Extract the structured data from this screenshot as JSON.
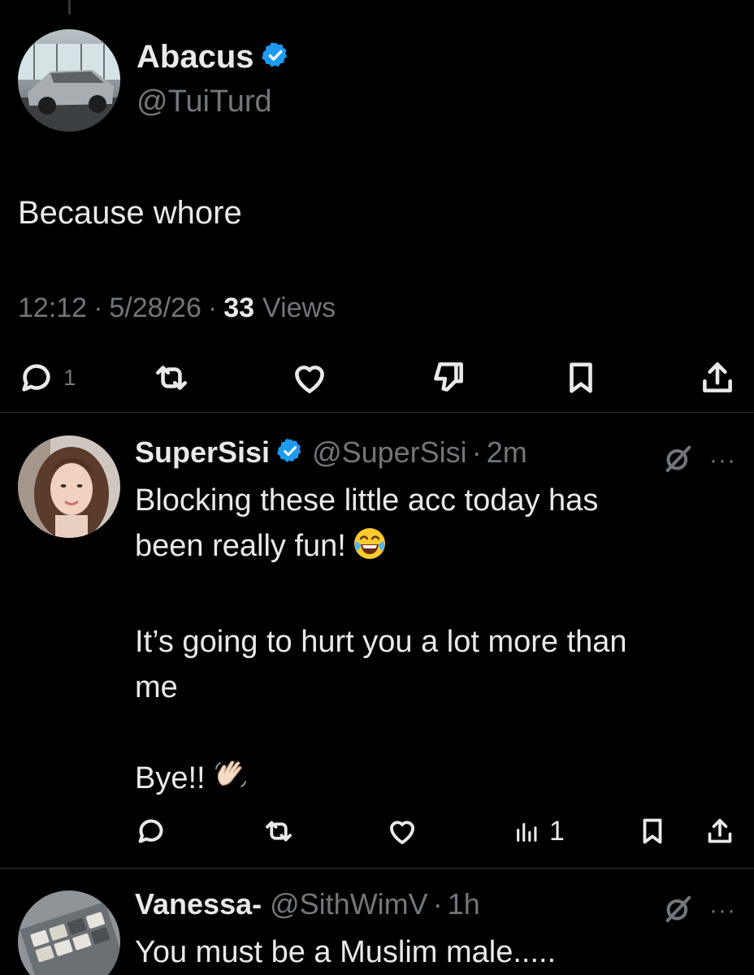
{
  "main_tweet": {
    "author_name": "Abacus",
    "author_handle": "@TuiTurd",
    "text": "Because whore",
    "time": "12:12",
    "date": "5/28/26",
    "views_count": "33",
    "views_label": "Views",
    "actions": {
      "reply_count": "1"
    }
  },
  "replies": [
    {
      "name": "SuperSisi",
      "handle": "@SuperSisi",
      "time": "2m",
      "more": "···",
      "lines": [
        "Blocking these little acc today has",
        "been really fun!",
        "It’s going to hurt you a lot  more than",
        "me",
        "Bye!!"
      ],
      "views_count": "1"
    },
    {
      "name": "Vanessa-",
      "handle": "@SithWimV",
      "time": "1h",
      "more": "···",
      "text": "You must be a Muslim male....."
    }
  ],
  "colors": {
    "background": "#000000",
    "text_primary": "#e7e9ea",
    "text_secondary": "#71767b",
    "verified_blue": "#1d9bf0",
    "divider": "#2f3336"
  },
  "icons": [
    "verified-badge-icon",
    "reply-icon",
    "retweet-icon",
    "like-icon",
    "dislike-icon",
    "bookmark-icon",
    "share-icon",
    "grok-icon",
    "views-icon",
    "more-icon",
    "laughing-emoji",
    "waving-hand-emoji"
  ]
}
